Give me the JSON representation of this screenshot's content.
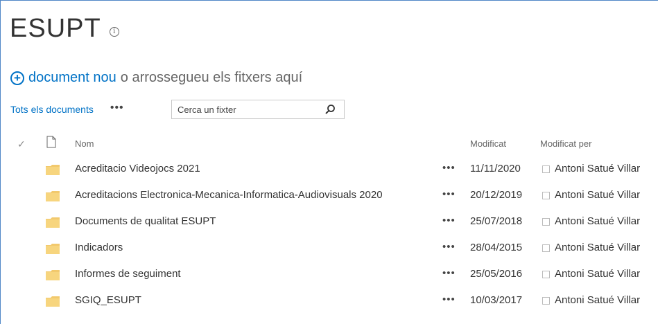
{
  "page": {
    "title": "ESUPT",
    "info_glyph": "i"
  },
  "new_document": {
    "plus_glyph": "+",
    "link_label": "document nou",
    "drop_text": "o arrossegueu els fitxers aquí"
  },
  "view": {
    "label": "Tots els documents",
    "more_glyph": "•••",
    "search_placeholder": "Cerca un fixter"
  },
  "columns": {
    "check_glyph": "✓",
    "name": "Nom",
    "modified": "Modificat",
    "modified_by": "Modificat per"
  },
  "rows": [
    {
      "name": "Acreditacio Videojocs 2021",
      "more": "•••",
      "modified": "11/11/2020",
      "modified_by": "Antoni Satué Villar"
    },
    {
      "name": "Acreditacions Electronica-Mecanica-Informatica-Audiovisuals 2020",
      "more": "•••",
      "modified": "20/12/2019",
      "modified_by": "Antoni Satué Villar"
    },
    {
      "name": "Documents de qualitat ESUPT",
      "more": "•••",
      "modified": "25/07/2018",
      "modified_by": "Antoni Satué Villar"
    },
    {
      "name": "Indicadors",
      "more": "•••",
      "modified": "28/04/2015",
      "modified_by": "Antoni Satué Villar"
    },
    {
      "name": "Informes de seguiment",
      "more": "•••",
      "modified": "25/05/2016",
      "modified_by": "Antoni Satué Villar"
    },
    {
      "name": "SGIQ_ESUPT",
      "more": "•••",
      "modified": "10/03/2017",
      "modified_by": "Antoni Satué Villar"
    }
  ],
  "icons": {
    "folder": "folder-icon",
    "document": "document-icon",
    "search": "search-icon",
    "info": "info-icon",
    "add": "plus-circle-icon"
  },
  "colors": {
    "accent": "#0072c6",
    "folder": "#f2c96d",
    "text": "#333333",
    "muted": "#666666"
  }
}
